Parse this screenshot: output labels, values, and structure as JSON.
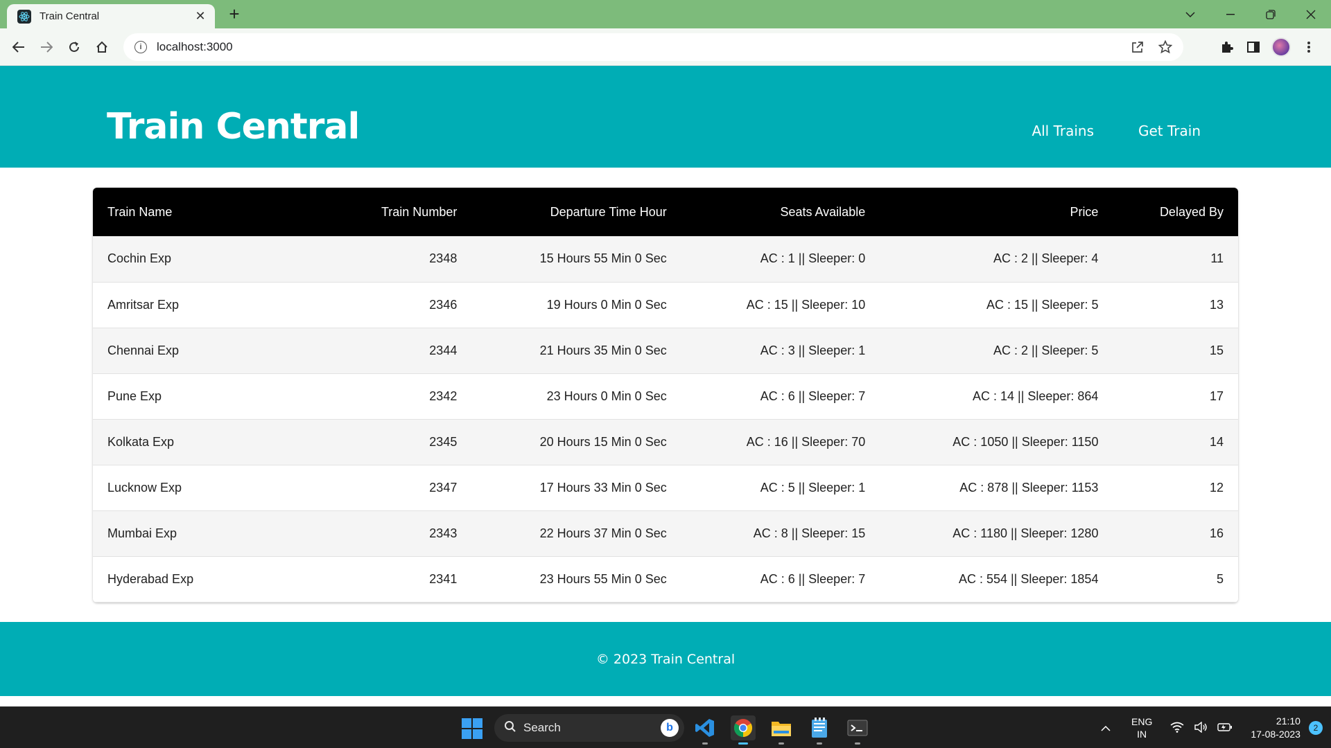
{
  "browser": {
    "tab_title": "Train Central",
    "url": "localhost:3000",
    "icons": [
      "react-favicon",
      "close-icon",
      "plus-icon",
      "chevron-down-icon",
      "minimize-icon",
      "restore-icon",
      "window-close-icon",
      "back-arrow-icon",
      "forward-arrow-icon",
      "reload-icon",
      "home-icon",
      "info-icon",
      "share-icon",
      "star-icon",
      "extensions-icon",
      "sidepanel-icon",
      "profile-avatar",
      "more-vert-icon"
    ]
  },
  "header": {
    "brand": "Train Central",
    "nav": [
      "All Trains",
      "Get Train"
    ]
  },
  "table": {
    "columns": [
      "Train Name",
      "Train Number",
      "Departure Time Hour",
      "Seats Available",
      "Price",
      "Delayed By"
    ],
    "rows": [
      [
        "Cochin Exp",
        "2348",
        "15 Hours 55 Min 0 Sec",
        "AC : 1 || Sleeper: 0",
        "AC : 2 || Sleeper: 4",
        "11"
      ],
      [
        "Amritsar Exp",
        "2346",
        "19 Hours 0 Min 0 Sec",
        "AC : 15 || Sleeper: 10",
        "AC : 15 || Sleeper: 5",
        "13"
      ],
      [
        "Chennai Exp",
        "2344",
        "21 Hours 35 Min 0 Sec",
        "AC : 3 || Sleeper: 1",
        "AC : 2 || Sleeper: 5",
        "15"
      ],
      [
        "Pune Exp",
        "2342",
        "23 Hours 0 Min 0 Sec",
        "AC : 6 || Sleeper: 7",
        "AC : 14 || Sleeper: 864",
        "17"
      ],
      [
        "Kolkata Exp",
        "2345",
        "20 Hours 15 Min 0 Sec",
        "AC : 16 || Sleeper: 70",
        "AC : 1050 || Sleeper: 1150",
        "14"
      ],
      [
        "Lucknow Exp",
        "2347",
        "17 Hours 33 Min 0 Sec",
        "AC : 5 || Sleeper: 1",
        "AC : 878 || Sleeper: 1153",
        "12"
      ],
      [
        "Mumbai Exp",
        "2343",
        "22 Hours 37 Min 0 Sec",
        "AC : 8 || Sleeper: 15",
        "AC : 1180 || Sleeper: 1280",
        "16"
      ],
      [
        "Hyderabad Exp",
        "2341",
        "23 Hours 55 Min 0 Sec",
        "AC : 6 || Sleeper: 7",
        "AC : 554 || Sleeper: 1854",
        "5"
      ]
    ]
  },
  "footer": {
    "text": "© 2023 Train Central"
  },
  "taskbar": {
    "search_placeholder": "Search",
    "lang_top": "ENG",
    "lang_bottom": "IN",
    "time": "21:10",
    "date": "17-08-2023",
    "notification_count": "2",
    "apps": [
      "windows-start-icon",
      "vscode-icon",
      "chrome-icon",
      "file-explorer-icon",
      "notepad-icon",
      "terminal-icon"
    ]
  },
  "colors": {
    "tabstrip": "#7dbb7b",
    "header_bg": "#00adb5",
    "table_header_bg": "#000000",
    "row_stripe": "#f5f5f5",
    "taskbar_bg": "#1f1f1f"
  }
}
